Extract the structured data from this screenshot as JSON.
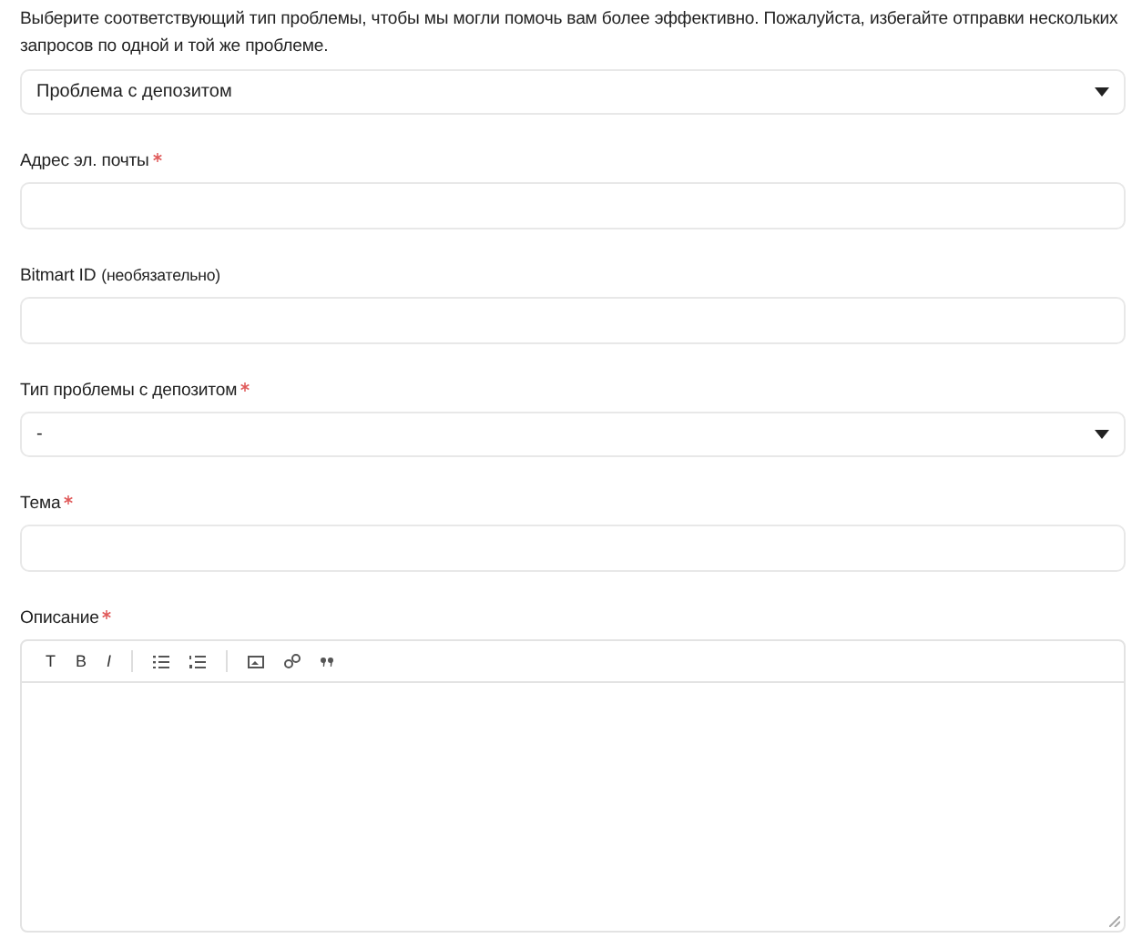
{
  "intro": "Выберите соответствующий тип проблемы, чтобы мы могли помочь вам более эффективно. Пожалуйста, избегайте отправки нескольких запросов по одной и той же проблеме.",
  "issue_type": {
    "value": "Проблема с депозитом"
  },
  "fields": [
    {
      "kind": "text",
      "label": "Адрес эл. почты",
      "required": true
    },
    {
      "kind": "text",
      "label": "Bitmart ID",
      "hint": "(необязательно)",
      "required": false
    },
    {
      "kind": "select",
      "label": "Тип проблемы с депозитом",
      "required": true,
      "value": "-"
    },
    {
      "kind": "text",
      "label": "Тема",
      "required": true
    }
  ],
  "description": {
    "label": "Описание",
    "required": true,
    "toolbar": [
      {
        "kind": "text",
        "label": "T"
      },
      {
        "kind": "bold",
        "label": "B"
      },
      {
        "kind": "italic",
        "label": "I"
      },
      {
        "kind": "sep"
      },
      {
        "kind": "bullets"
      },
      {
        "kind": "numbers"
      },
      {
        "kind": "sep"
      },
      {
        "kind": "image"
      },
      {
        "kind": "link"
      },
      {
        "kind": "quote"
      }
    ]
  }
}
